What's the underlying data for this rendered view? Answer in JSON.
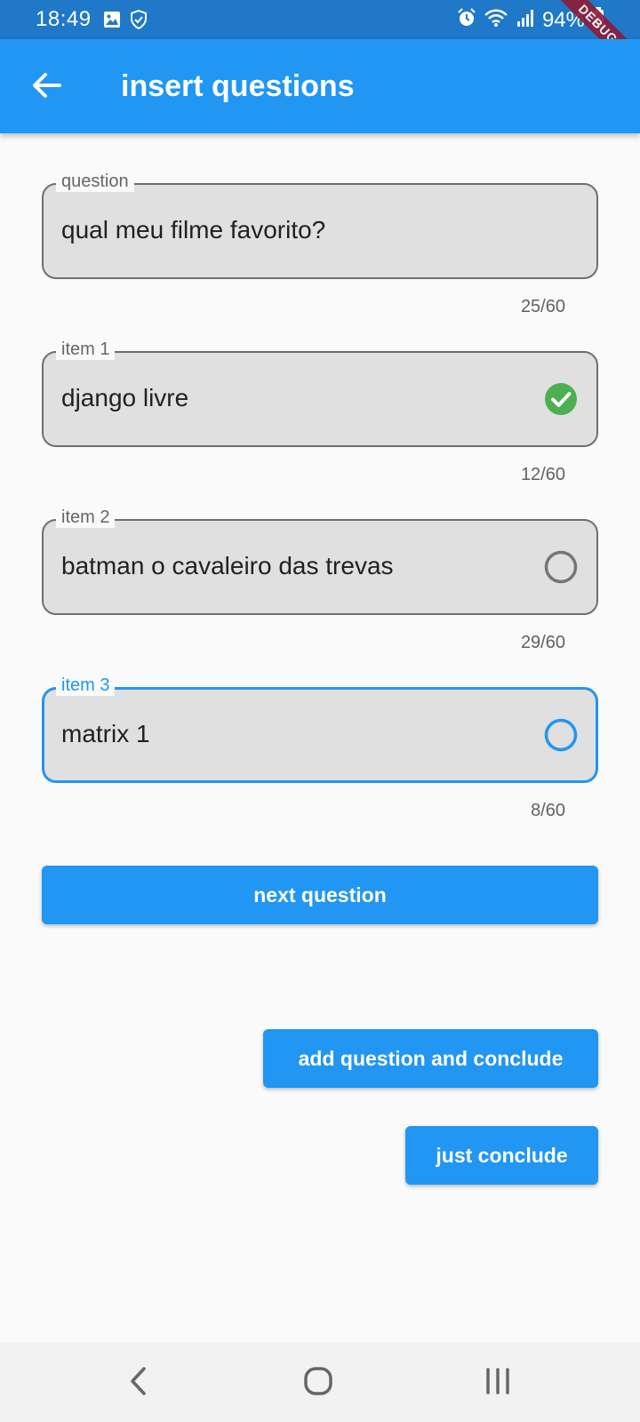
{
  "status_bar": {
    "time": "18:49",
    "battery": "94%",
    "icons": [
      "image-icon",
      "shield-icon",
      "alarm-icon",
      "wifi-icon",
      "signal-icon",
      "battery-icon"
    ]
  },
  "debug_banner": "DEBUG",
  "app_bar": {
    "title": "insert questions",
    "back_icon": "arrow-back-icon"
  },
  "form": {
    "question": {
      "label": "question",
      "value": "qual meu filme favorito?",
      "counter": "25/60"
    },
    "items": [
      {
        "label": "item 1",
        "value": "django livre",
        "counter": "12/60",
        "selected": true
      },
      {
        "label": "item 2",
        "value": "batman o cavaleiro das trevas",
        "counter": "29/60",
        "selected": false
      },
      {
        "label": "item 3",
        "value": "matrix 1",
        "counter": "8/60",
        "selected": false,
        "focused": true
      }
    ]
  },
  "buttons": {
    "next_question": "next question",
    "add_and_conclude": "add question and conclude",
    "just_conclude": "just conclude"
  },
  "colors": {
    "primary": "#2196f3",
    "status_bar": "#1f78c8",
    "check_green": "#4caf50"
  }
}
